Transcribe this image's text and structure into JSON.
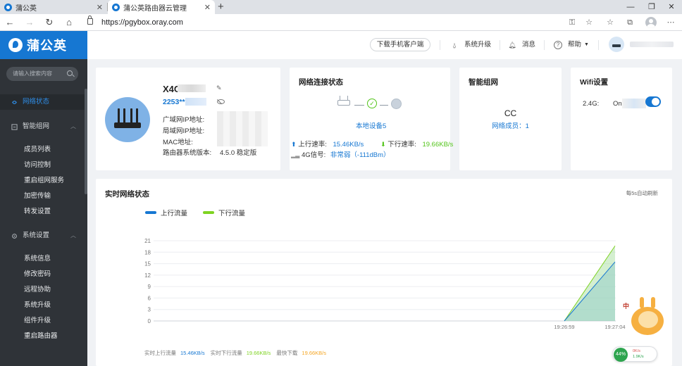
{
  "browser": {
    "tabs": [
      {
        "label": "蒲公英",
        "close": "✕"
      },
      {
        "label": "蒲公英路由器云管理",
        "close": "✕"
      }
    ],
    "new_tab": "+",
    "url": "https://pgybox.oray.com"
  },
  "sidebar": {
    "logo": "蒲公英",
    "search_placeholder": "请输入搜索内容",
    "items": [
      {
        "label": "网络状态"
      },
      {
        "label": "智能组网",
        "sub": [
          "成员列表",
          "访问控制",
          "重启组网服务",
          "加密传输",
          "转发设置"
        ]
      },
      {
        "label": "系统设置",
        "sub": [
          "系统信息",
          "修改密码",
          "远程协助",
          "系统升级",
          "组件升级",
          "重启路由器"
        ]
      }
    ]
  },
  "header": {
    "download_app": "下载手机客户端",
    "system_upgrade": "系统升级",
    "messages": "消息",
    "help": "帮助"
  },
  "device": {
    "name": "X4C",
    "sn": "2253**",
    "wan_ip_label": "广域网IP地址:",
    "lan_ip_label": "局域网IP地址:",
    "mac_label": "MAC地址:",
    "version_label": "路由器系统版本:",
    "version_value": "4.5.0 稳定版"
  },
  "network": {
    "title": "网络连接状态",
    "devices": "本地设备5",
    "up_label": "上行速率:",
    "up_value": "15.46KB/s",
    "down_label": "下行速率:",
    "down_value": "19.66KB/s",
    "signal_label": "4G信号:",
    "signal_value": "非常弱（-111dBm）"
  },
  "mesh": {
    "title": "智能组网",
    "name": "CC",
    "members": "网络成员：1"
  },
  "wifi": {
    "title": "Wifi设置",
    "band": "2.4G:",
    "state": "On"
  },
  "realtime": {
    "title": "实时网络状态",
    "auto_refresh": "每5s自动刷新",
    "stats": {
      "up_label": "实时上行流量",
      "up_value": "15.46KB/s",
      "down_label": "实时下行流量",
      "down_value": "19.66KB/s",
      "max_label": "最快下载",
      "max_value": "19.66KB/s"
    }
  },
  "chart_data": {
    "type": "area",
    "title": "实时网络状态",
    "x": [
      "19:26:59",
      "19:27:04"
    ],
    "xlabel": "",
    "ylabel": "",
    "ylim": [
      0,
      21
    ],
    "yticks": [
      0,
      3,
      6,
      9,
      12,
      15,
      18,
      21
    ],
    "grid": true,
    "legend_position": "top-left",
    "series": [
      {
        "name": "上行流量",
        "color": "#1677d2",
        "values": [
          0,
          15.46
        ]
      },
      {
        "name": "下行流量",
        "color": "#7ed321",
        "values": [
          0,
          19.66
        ]
      }
    ]
  },
  "widgets": {
    "mascot_label": "中",
    "meter_percent": "44%",
    "meter_up": "0K/s",
    "meter_down": "1.9K/s"
  },
  "colors": {
    "brand": "#1677d2",
    "upload": "#1677d2",
    "download": "#7ed321",
    "sidebar_bg": "#2f3338"
  }
}
